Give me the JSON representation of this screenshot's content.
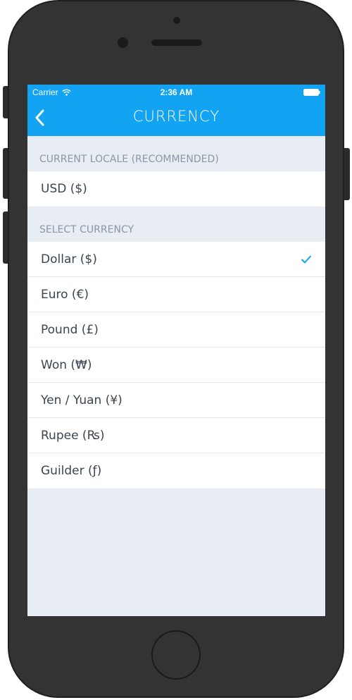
{
  "status_bar": {
    "carrier": "Carrier",
    "time": "2:36 AM"
  },
  "navbar": {
    "title": "CURRENCY",
    "back_icon": "chevron-left-icon"
  },
  "sections": {
    "current_locale": {
      "header": "CURRENT LOCALE (RECOMMENDED)",
      "items": [
        "USD ($)"
      ]
    },
    "select_currency": {
      "header": "SELECT CURRENCY",
      "items": [
        "Dollar ($)",
        "Euro (€)",
        "Pound (£)",
        "Won (₩)",
        "Yen / Yuan (¥)",
        "Rupee (₨)",
        "Guilder (ƒ)"
      ],
      "selected_index": 0
    }
  },
  "colors": {
    "accent": "#12a4f3",
    "background": "#e8edf4",
    "phone_body": "#333333"
  }
}
